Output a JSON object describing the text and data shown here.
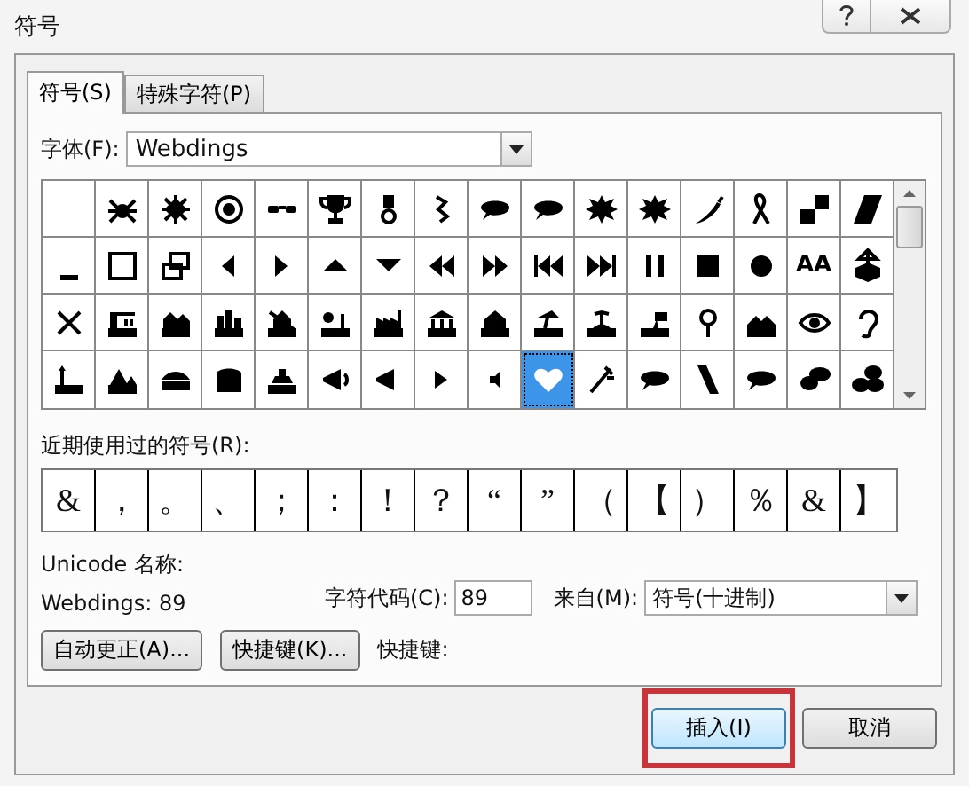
{
  "window": {
    "title": "符号"
  },
  "tabs": [
    {
      "label": "符号(S)",
      "selected": true
    },
    {
      "label": "特殊字符(P)",
      "selected": false
    }
  ],
  "font": {
    "label": "字体(F):",
    "value": "Webdings"
  },
  "symbols": [
    {
      "selected": false
    },
    {
      "selected": false
    },
    {
      "selected": false
    },
    {
      "selected": false
    },
    {
      "selected": false
    },
    {
      "selected": false
    },
    {
      "selected": false
    },
    {
      "selected": false
    },
    {
      "selected": false
    },
    {
      "selected": false
    },
    {
      "selected": false
    },
    {
      "selected": false
    },
    {
      "selected": false
    },
    {
      "selected": false
    },
    {
      "selected": false
    },
    {
      "selected": false
    },
    {
      "selected": false
    },
    {
      "selected": false
    },
    {
      "selected": false
    },
    {
      "selected": false
    },
    {
      "selected": false
    },
    {
      "selected": false
    },
    {
      "selected": false
    },
    {
      "selected": false
    },
    {
      "selected": false
    },
    {
      "selected": false
    },
    {
      "selected": false
    },
    {
      "selected": false
    },
    {
      "selected": false
    },
    {
      "selected": false
    },
    {
      "selected": false,
      "glyph": "AA"
    },
    {
      "selected": false
    },
    {
      "selected": false
    },
    {
      "selected": false
    },
    {
      "selected": false
    },
    {
      "selected": false
    },
    {
      "selected": false
    },
    {
      "selected": false
    },
    {
      "selected": false
    },
    {
      "selected": false
    },
    {
      "selected": false
    },
    {
      "selected": false
    },
    {
      "selected": false
    },
    {
      "selected": false
    },
    {
      "selected": false
    },
    {
      "selected": false
    },
    {
      "selected": false
    },
    {
      "selected": false
    },
    {
      "selected": false
    },
    {
      "selected": false
    },
    {
      "selected": false
    },
    {
      "selected": false
    },
    {
      "selected": false
    },
    {
      "selected": false
    },
    {
      "selected": false
    },
    {
      "selected": false
    },
    {
      "selected": false
    },
    {
      "selected": true
    },
    {
      "selected": false
    },
    {
      "selected": false
    },
    {
      "selected": false
    },
    {
      "selected": false
    },
    {
      "selected": false
    },
    {
      "selected": false
    }
  ],
  "recent": {
    "label": "近期使用过的符号(R):",
    "symbols": [
      "&",
      "，",
      "。",
      "、",
      "；",
      "：",
      "！",
      "？",
      "“",
      "”",
      "（",
      "【",
      "）",
      "％",
      "&",
      "】"
    ]
  },
  "unicode_name": {
    "label": "Unicode 名称:",
    "value": "Webdings: 89"
  },
  "char_code": {
    "label": "字符代码(C):",
    "value": "89"
  },
  "from": {
    "label": "来自(M):",
    "value": "符号(十进制)"
  },
  "buttons": [
    {
      "label": "自动更正(A)..."
    },
    {
      "label": "快捷键(K)..."
    }
  ],
  "shortcut_label": "快捷键:",
  "footer": [
    {
      "label": "插入(I)",
      "highlighted": true
    },
    {
      "label": "取消",
      "highlighted": false
    }
  ]
}
